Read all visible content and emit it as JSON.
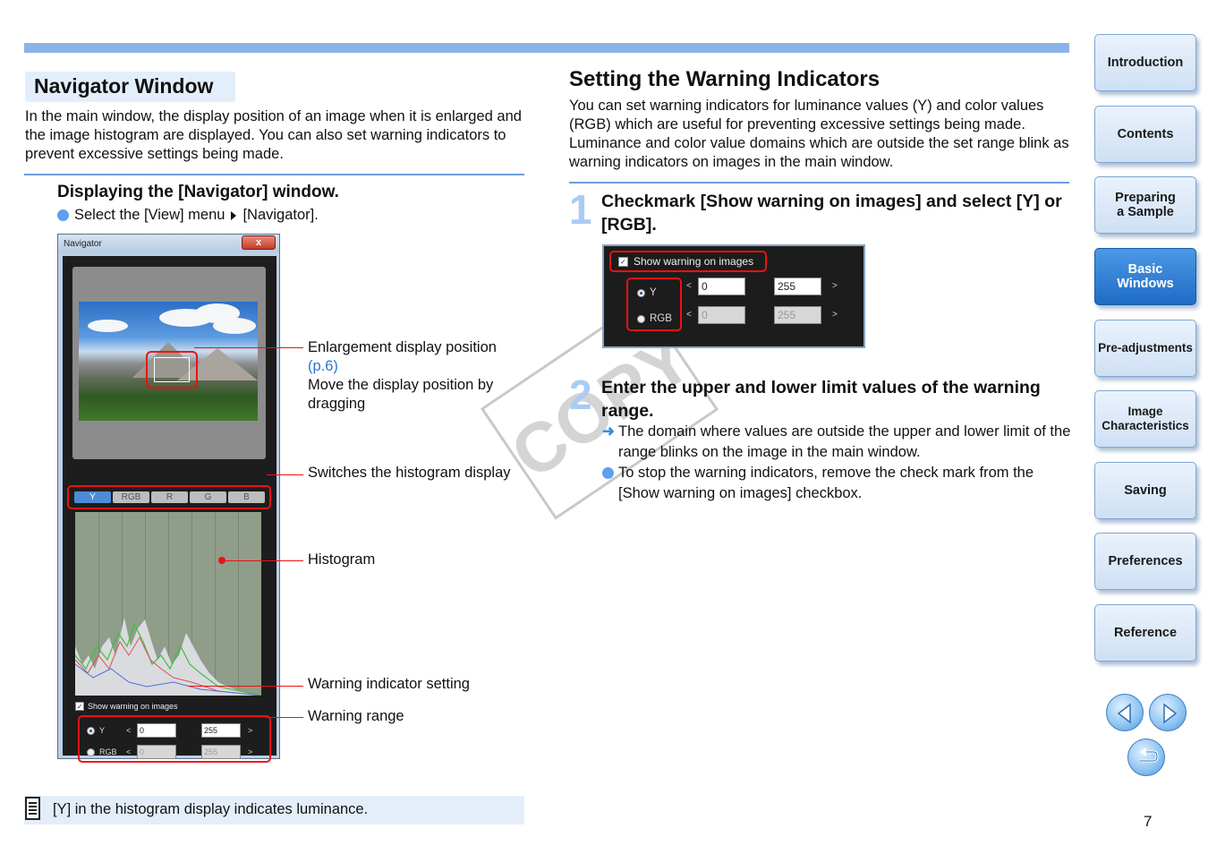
{
  "left": {
    "title": "Navigator Window",
    "intro": "In the main window, the display position of an image when it is enlarged and the image histogram are displayed. You can also set warning indicators to prevent excessive settings being made.",
    "sub_title": "Displaying the [Navigator] window.",
    "instruction_part1": "Select the [View] menu",
    "instruction_part2": "[Navigator].",
    "navigator": {
      "window_title": "Navigator",
      "close_label": "x",
      "tabs": [
        "Y",
        "RGB",
        "R",
        "G",
        "B"
      ],
      "show_warning_label": "Show warning on images",
      "y_label": "Y",
      "rgb_label": "RGB",
      "lt": "<",
      "gt": ">",
      "y_low": "0",
      "y_high": "255",
      "rgb_low": "0",
      "rgb_high": "255"
    },
    "callouts": {
      "enlargement": "Enlargement display position",
      "enlargement_link": "(p.6)",
      "enlargement_desc": "Move the display position by dragging",
      "switches": "Switches the histogram display",
      "histogram": "Histogram",
      "warning_setting": "Warning indicator setting",
      "warning_range": "Warning range"
    },
    "note": "[Y] in the histogram display indicates luminance."
  },
  "right": {
    "title": "Setting the Warning Indicators",
    "intro": "You can set warning indicators for luminance values (Y) and color values (RGB) which are useful for preventing excessive settings being made. Luminance and color value domains which are outside the set range blink as warning indicators on images in the main window.",
    "step1_num": "1",
    "step1_text": "Checkmark [Show warning on images] and select [Y] or [RGB].",
    "panel": {
      "show_warning_label": "Show warning on images",
      "y_label": "Y",
      "rgb_label": "RGB",
      "lt": "<",
      "gt": ">",
      "y_low": "0",
      "y_high": "255",
      "rgb_low": "0",
      "rgb_high": "255"
    },
    "step2_num": "2",
    "step2_text": "Enter the upper and lower limit values of the warning range.",
    "result_arrow": "➜",
    "result_text": "The domain where values are outside the upper and lower limit of the range blinks on the image in the main window.",
    "tip_text": "To stop the warning indicators, remove the check mark from the [Show warning on images] checkbox.",
    "watermark": "COPY"
  },
  "side_nav": {
    "items": [
      {
        "label": "Introduction"
      },
      {
        "label": "Contents"
      },
      {
        "label": "Preparing a Sample"
      },
      {
        "label": "Basic Windows"
      },
      {
        "label": "Pre-adjustments"
      },
      {
        "label": "Image Characteristics"
      },
      {
        "label": "Saving"
      },
      {
        "label": "Preferences"
      },
      {
        "label": "Reference"
      }
    ],
    "active_index": 3
  },
  "page_number": "7",
  "colors": {
    "accent_blue": "#5ea0ee",
    "rule_blue": "#6d9de0",
    "highlight_red": "#e11111",
    "nav_active": "#2a78d0"
  }
}
